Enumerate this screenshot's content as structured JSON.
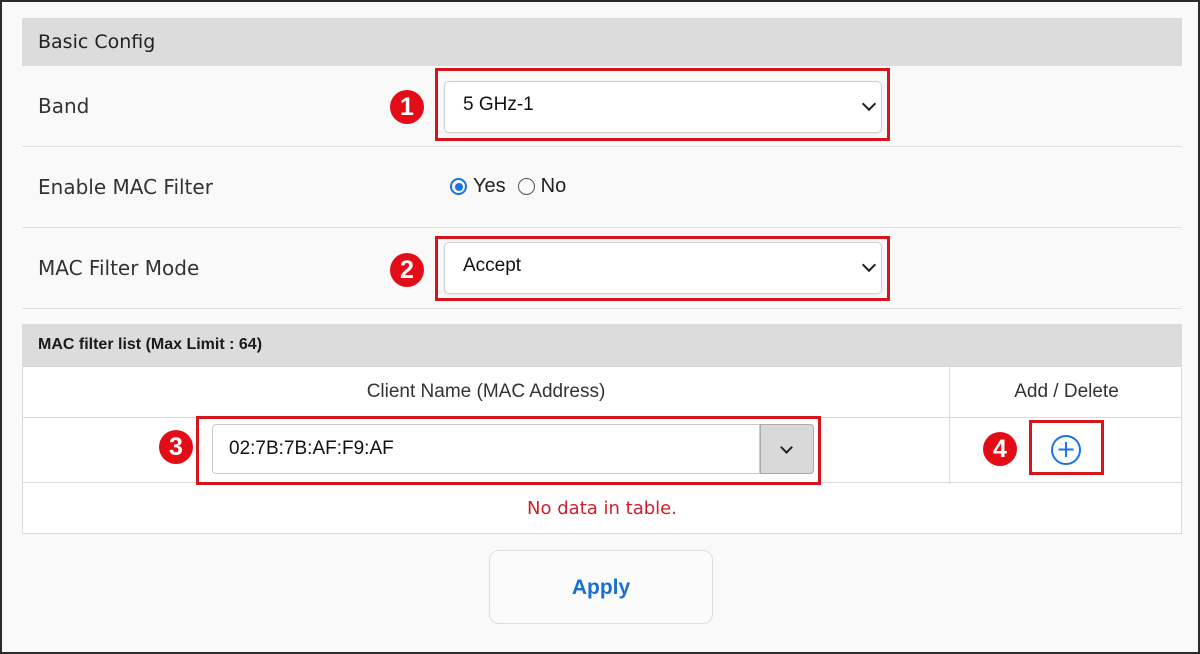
{
  "basic_config": {
    "title": "Basic Config",
    "band": {
      "label": "Band",
      "value": "5 GHz-1",
      "marker": "1"
    },
    "mac_filter": {
      "label": "Enable MAC Filter",
      "options": [
        "Yes",
        "No"
      ],
      "selected": "Yes"
    },
    "mac_mode": {
      "label": "MAC Filter Mode",
      "value": "Accept",
      "marker": "2"
    }
  },
  "mac_list": {
    "title": "MAC filter list (Max Limit : 64)",
    "columns": [
      "Client Name (MAC Address)",
      "Add / Delete"
    ],
    "input_value": "02:7B:7B:AF:F9:AF",
    "input_marker": "3",
    "add_marker": "4",
    "add_icon": "plus-circle-icon",
    "empty_text": "No data in table."
  },
  "apply_label": "Apply",
  "colors": {
    "highlight": "#d6141c",
    "accent": "#1a73e8",
    "empty_text": "#d01f2a",
    "header_bg": "#dcdcdc"
  }
}
